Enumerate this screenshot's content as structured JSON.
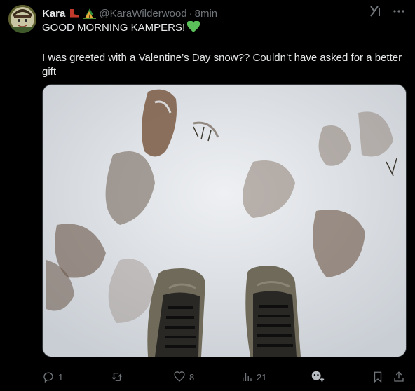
{
  "tweet": {
    "author_name": "Kara",
    "handle": "@KaraWilderwood",
    "separator": "·",
    "time": "8min",
    "line1": "GOOD MORNING KAMPERS!",
    "line2": "I was greeted with a Valentine’s Day snow?? Couldn’t have asked for a better gift"
  },
  "icons": {
    "name_emojis": [
      "boot-emoji",
      "camping-emoji"
    ],
    "heart_emoji": "green-heart-emoji",
    "grok": "grok-icon",
    "more": "more-icon"
  },
  "colors": {
    "background": "#000000",
    "text": "#e7e9ea",
    "muted": "#71767b",
    "heart": "#5cc05a"
  },
  "actions": {
    "reply_count": "1",
    "repost_count": "",
    "like_count": "8",
    "views_count": "21"
  }
}
